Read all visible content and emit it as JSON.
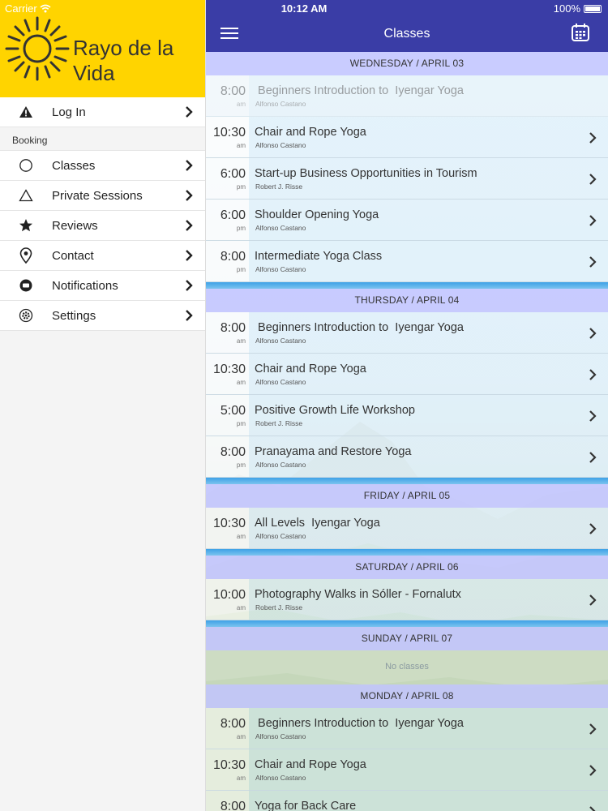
{
  "status_bar": {
    "carrier": "Carrier",
    "time": "10:12 AM",
    "battery": "100%"
  },
  "sidebar": {
    "brand": "Rayo de la Vida",
    "top_items": [
      {
        "label": "Log In",
        "icon": "warning-icon"
      }
    ],
    "section": "Booking",
    "items": [
      {
        "label": "Classes",
        "icon": "circle-icon"
      },
      {
        "label": "Private Sessions",
        "icon": "triangle-icon"
      },
      {
        "label": "Reviews",
        "icon": "star-icon"
      },
      {
        "label": "Contact",
        "icon": "location-pin-icon"
      },
      {
        "label": "Notifications",
        "icon": "chat-bubble-icon"
      },
      {
        "label": "Settings",
        "icon": "gear-icon"
      }
    ]
  },
  "navbar": {
    "title": "Classes"
  },
  "days": [
    {
      "header": "WEDNESDAY / APRIL 03",
      "classes": [
        {
          "time": "8:00",
          "ampm": "am",
          "title": " Beginners Introduction to  Iyengar Yoga",
          "teacher": "Alfonso Castano",
          "faded": true
        },
        {
          "time": "10:30",
          "ampm": "am",
          "title": "Chair and Rope Yoga",
          "teacher": "Alfonso Castano"
        },
        {
          "time": "6:00",
          "ampm": "pm",
          "title": "Start-up Business Opportunities in Tourism",
          "teacher": "Robert J. Risse"
        },
        {
          "time": "6:00",
          "ampm": "pm",
          "title": "Shoulder Opening Yoga",
          "teacher": "Alfonso Castano"
        },
        {
          "time": "8:00",
          "ampm": "pm",
          "title": "Intermediate Yoga Class",
          "teacher": "Alfonso Castano"
        }
      ]
    },
    {
      "header": "THURSDAY / APRIL 04",
      "classes": [
        {
          "time": "8:00",
          "ampm": "am",
          "title": " Beginners Introduction to  Iyengar Yoga",
          "teacher": "Alfonso Castano"
        },
        {
          "time": "10:30",
          "ampm": "am",
          "title": "Chair and Rope Yoga",
          "teacher": "Alfonso Castano"
        },
        {
          "time": "5:00",
          "ampm": "pm",
          "title": "Positive Growth Life Workshop",
          "teacher": "Robert J. Risse"
        },
        {
          "time": "8:00",
          "ampm": "pm",
          "title": "Pranayama and Restore Yoga",
          "teacher": "Alfonso Castano"
        }
      ]
    },
    {
      "header": "FRIDAY / APRIL 05",
      "classes": [
        {
          "time": "10:30",
          "ampm": "am",
          "title": "All Levels  Iyengar Yoga",
          "teacher": "Alfonso Castano"
        }
      ]
    },
    {
      "header": "SATURDAY / APRIL 06",
      "classes": [
        {
          "time": "10:00",
          "ampm": "am",
          "title": "Photography Walks in Sóller - Fornalutx",
          "teacher": "Robert J. Risse"
        }
      ]
    },
    {
      "header": "SUNDAY / APRIL 07",
      "classes": [],
      "empty_text": "No classes"
    },
    {
      "header": "MONDAY / APRIL 08",
      "classes": [
        {
          "time": "8:00",
          "ampm": "am",
          "title": " Beginners Introduction to  Iyengar Yoga",
          "teacher": "Alfonso Castano"
        },
        {
          "time": "10:30",
          "ampm": "am",
          "title": "Chair and Rope Yoga",
          "teacher": "Alfonso Castano"
        },
        {
          "time": "8:00",
          "ampm": "",
          "title": "Yoga for Back Care",
          "teacher": ""
        }
      ]
    }
  ],
  "colors": {
    "brand_yellow": "#ffd400",
    "navbar": "#3a3da6",
    "day_header": "#c5c8ff",
    "separator": "#3ea2e6"
  }
}
